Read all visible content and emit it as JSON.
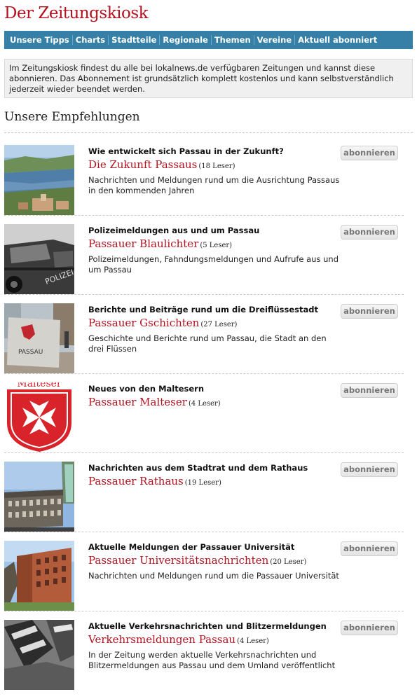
{
  "site": {
    "title": "Der Zeitungskiosk"
  },
  "nav": {
    "items": [
      "Unsere Tipps",
      "Charts",
      "Stadtteile",
      "Regionale",
      "Themen",
      "Vereine",
      "Aktuell abonniert"
    ]
  },
  "intro": {
    "text": "Im Zeitungskiosk findest du alle bei lokalnews.de verfügbaren Zeitungen und kannst diese abonnieren. Das Abonnement ist grundsätzlich komplett kostenlos und kann selbstverständlich jederzeit wieder beendet werden."
  },
  "section": {
    "title": "Unsere Empfehlungen"
  },
  "items": [
    {
      "teaser": "Wie entwickelt sich Passau in der Zukunft?",
      "name": "Die Zukunft Passaus",
      "readers": "(18 Leser)",
      "description": "Nachrichten und Meldungen rund um die Ausrichtung Passaus in den kommenden Jahren",
      "button": "abonnieren",
      "image": "passau-panorama-photo"
    },
    {
      "teaser": "Polizeimeldungen aus und um Passau",
      "name": "Passauer Blaulichter",
      "readers": "(5 Leser)",
      "description": "Polizeimeldungen, Fahndungsmeldungen und Aufrufe aus und um Passau",
      "button": "abonnieren",
      "image": "police-car-photo"
    },
    {
      "teaser": "Berichte und Beiträge rund um die Dreiflüssestadt",
      "name": "Passauer Gschichten",
      "readers": "(27 Leser)",
      "description": "Geschichte und Berichte rund um Passau, die Stadt an den drei Flüssen",
      "button": "abonnieren",
      "image": "passau-sign-photo",
      "image_text": "PASSAU"
    },
    {
      "teaser": "Neues von den Maltesern",
      "name": "Passauer Malteser",
      "readers": "(4 Leser)",
      "description": "",
      "button": "abonnieren",
      "image": "malteser-logo",
      "image_text": "Malteser"
    },
    {
      "teaser": "Nachrichten aus dem Stadtrat und dem Rathaus",
      "name": "Passauer Rathaus",
      "readers": "(19 Leser)",
      "description": "",
      "button": "abonnieren",
      "image": "city-hall-photo"
    },
    {
      "teaser": "Aktuelle Meldungen der Passauer Universität",
      "name": "Passauer Universitätsnachrichten",
      "readers": "(20 Leser)",
      "description": "Nachrichten und Meldungen rund um die Passauer Universität",
      "button": "abonnieren",
      "image": "university-building-photo"
    },
    {
      "teaser": "Aktuelle Verkehrsnachrichten und Blitzermeldungen",
      "name": "Verkehrsmeldungen Passau",
      "readers": "(4 Leser)",
      "description": "In der Zeitung werden aktuelle Verkehrsnachrichten und Blitzermeldungen aus Passau und dem Umland veröffentlicht",
      "button": "abonnieren",
      "image": "traffic-photo"
    }
  ],
  "colors": {
    "accent": "#b3121f",
    "nav": "#3680a8"
  }
}
